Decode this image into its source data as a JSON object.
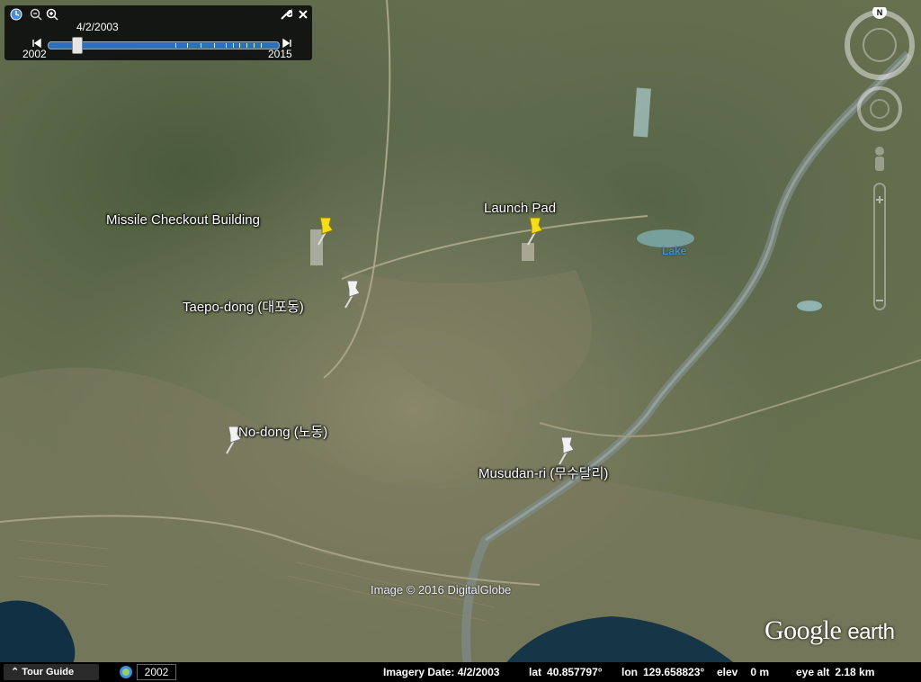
{
  "time_slider": {
    "current_date": "4/2/2003",
    "start_year": "2002",
    "end_year": "2015",
    "position": 0.12
  },
  "placemarks": [
    {
      "label": "Missile Checkout Building",
      "pin_color": "yellow"
    },
    {
      "label": "Launch Pad",
      "pin_color": "yellow"
    },
    {
      "label": "Taepo-dong (대포동)",
      "pin_color": "white"
    },
    {
      "label": "No-dong (노동)",
      "pin_color": "white"
    },
    {
      "label": "Musudan-ri (무수달리)",
      "pin_color": "white"
    }
  ],
  "map_labels": {
    "lake": "Lake"
  },
  "attribution": "Image © 2016 DigitalGlobe",
  "branding": {
    "google": "Google",
    "earth": "earth"
  },
  "navigation": {
    "north_label": "N"
  },
  "status_bar": {
    "tour_guide": "Tour Guide",
    "history_year": "2002",
    "imagery_date_label": "Imagery Date:",
    "imagery_date": "4/2/2003",
    "lat_label": "lat",
    "lat": "40.857797°",
    "lon_label": "lon",
    "lon": "129.658823°",
    "elev_label": "elev",
    "elev": "0 m",
    "eye_alt_label": "eye alt",
    "eye_alt": "2.18 km"
  },
  "colors": {
    "pin_yellow": "#f3dd1a",
    "pin_white": "#f2f2f2",
    "lake_label": "#3f8fe0"
  }
}
